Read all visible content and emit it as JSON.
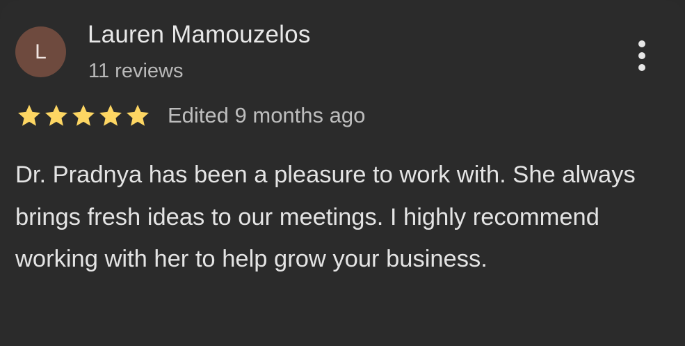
{
  "review": {
    "avatar_initial": "L",
    "avatar_color": "#6e4a3e",
    "author_name": "Lauren Mamouzelos",
    "review_count": "11 reviews",
    "rating": 5,
    "rating_max": 5,
    "star_color": "#fdd663",
    "edited_text": "Edited 9 months ago",
    "body": "Dr. Pradnya has been a pleasure to work with. She always brings fresh ideas to our meetings. I highly recommend working with her to help grow your business."
  },
  "icons": {
    "more": "more-vert-icon",
    "star": "star-icon"
  }
}
